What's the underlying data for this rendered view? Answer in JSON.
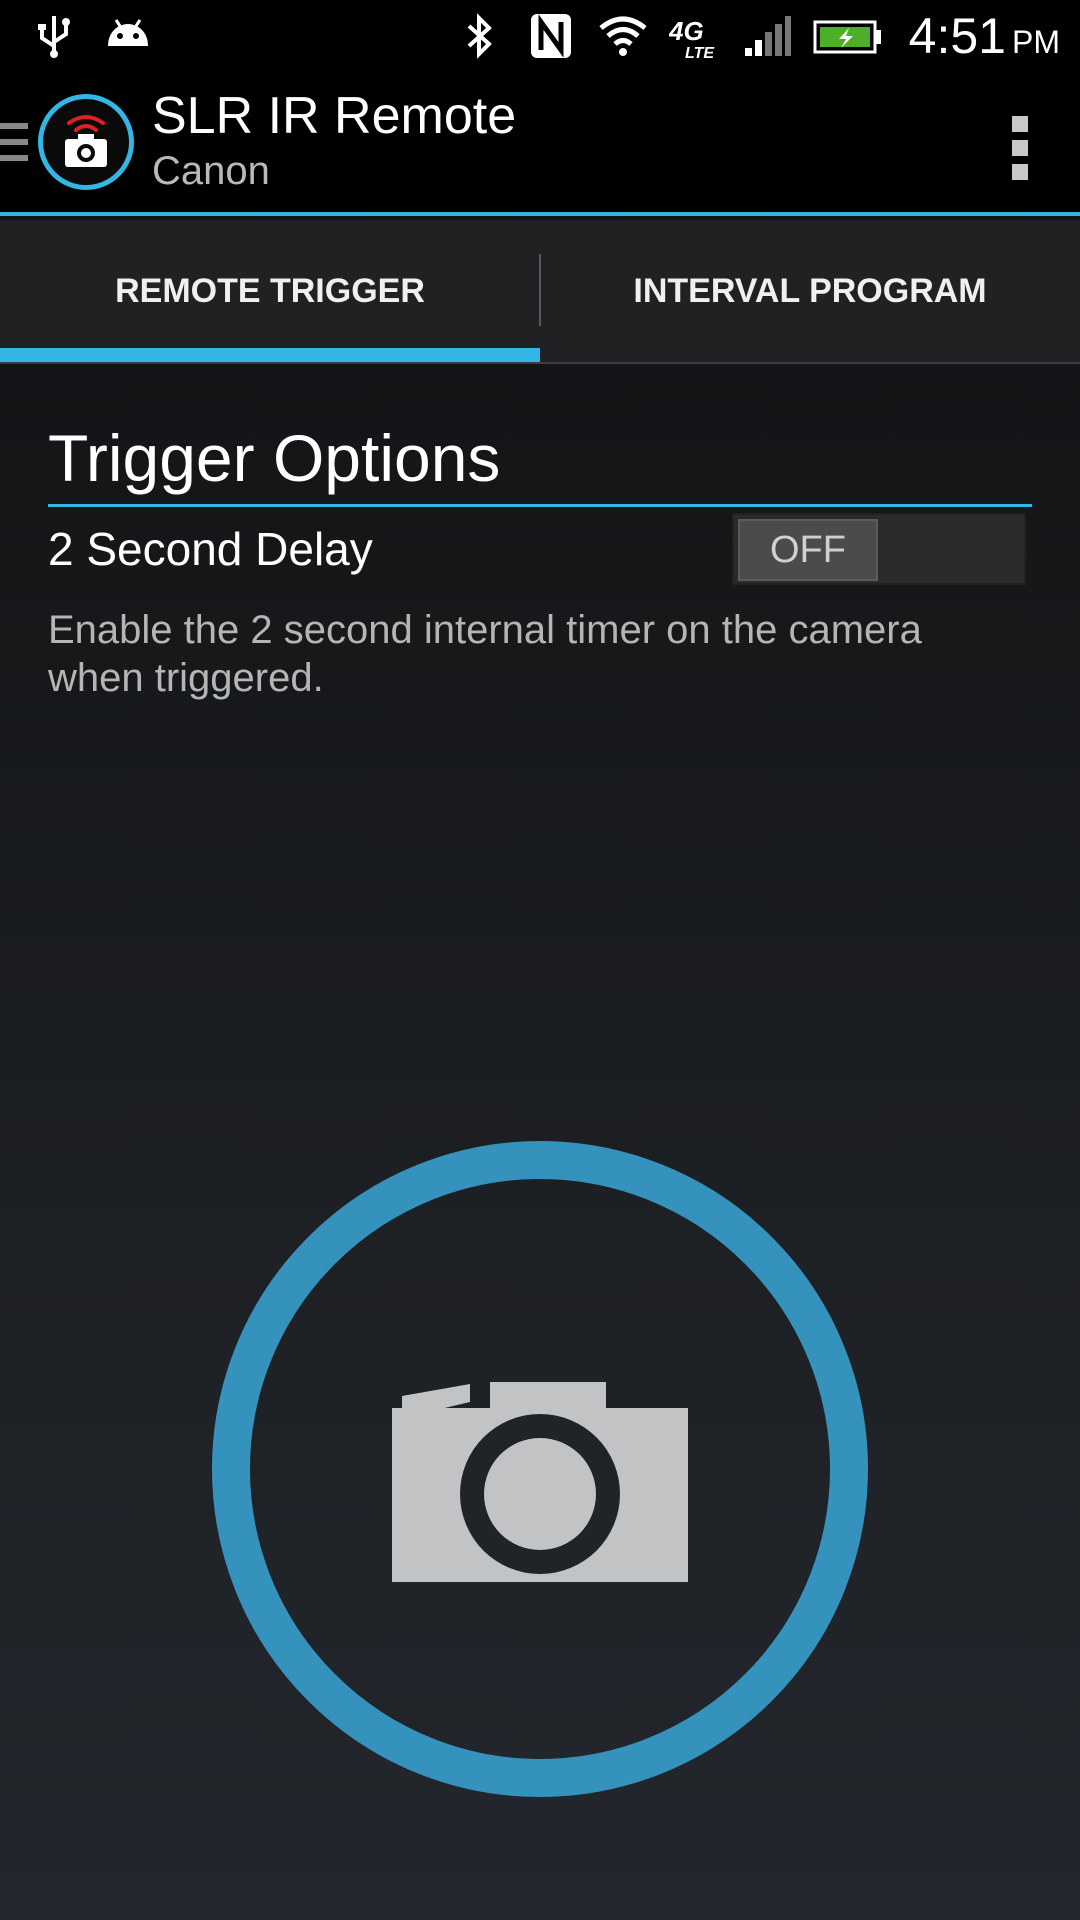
{
  "status_bar": {
    "icons": [
      "usb-icon",
      "android-icon",
      "bluetooth-icon",
      "nfc-icon",
      "wifi-icon",
      "4g-lte-icon",
      "signal-icon",
      "battery-charging-icon"
    ],
    "lte_label": "4G",
    "time": "4:51",
    "ampm": "PM"
  },
  "action_bar": {
    "title": "SLR IR Remote",
    "subtitle": "Canon",
    "logo_icon": "camera-ir-icon",
    "menu_icon": "overflow-menu-icon"
  },
  "tabs": [
    {
      "label": "REMOTE TRIGGER",
      "active": true
    },
    {
      "label": "INTERVAL PROGRAM",
      "active": false
    }
  ],
  "trigger_options": {
    "title": "Trigger Options",
    "delay_label": "2 Second Delay",
    "delay_toggle": "OFF",
    "delay_description": "Enable the 2 second internal timer on the camera when triggered."
  },
  "shutter": {
    "icon": "camera-icon"
  },
  "colors": {
    "accent": "#33b5e5",
    "ring": "#3592bd",
    "logo_signal": "#e02020"
  }
}
